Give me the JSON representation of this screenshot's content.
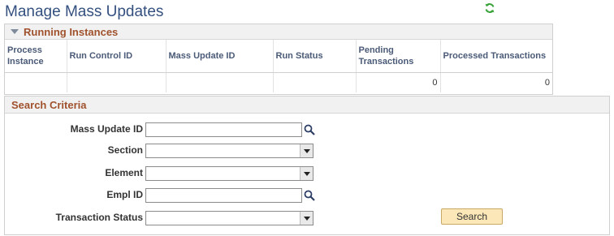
{
  "page": {
    "title": "Manage Mass Updates"
  },
  "icons": {
    "refresh": "refresh-icon",
    "lookup": "magnifier-icon",
    "collapse": "triangle-down-icon"
  },
  "running_instances": {
    "title": "Running Instances",
    "columns": [
      "Process Instance",
      "Run Control ID",
      "Mass Update ID",
      "Run Status",
      "Pending Transactions",
      "Processed Transactions"
    ],
    "rows": [
      {
        "process_instance": "",
        "run_control_id": "",
        "mass_update_id": "",
        "run_status": "",
        "pending_transactions": "0",
        "processed_transactions": "0"
      }
    ]
  },
  "search_criteria": {
    "title": "Search Criteria",
    "fields": {
      "mass_update_id": {
        "label": "Mass Update ID",
        "value": ""
      },
      "section": {
        "label": "Section",
        "value": ""
      },
      "element": {
        "label": "Element",
        "value": ""
      },
      "empl_id": {
        "label": "Empl ID",
        "value": ""
      },
      "transaction_status": {
        "label": "Transaction Status",
        "value": ""
      }
    },
    "search_button": "Search"
  },
  "colors": {
    "title": "#34507f",
    "section_title": "#a0522d",
    "button_bg": "#fbe7b7",
    "refresh": "#3aa33a"
  }
}
